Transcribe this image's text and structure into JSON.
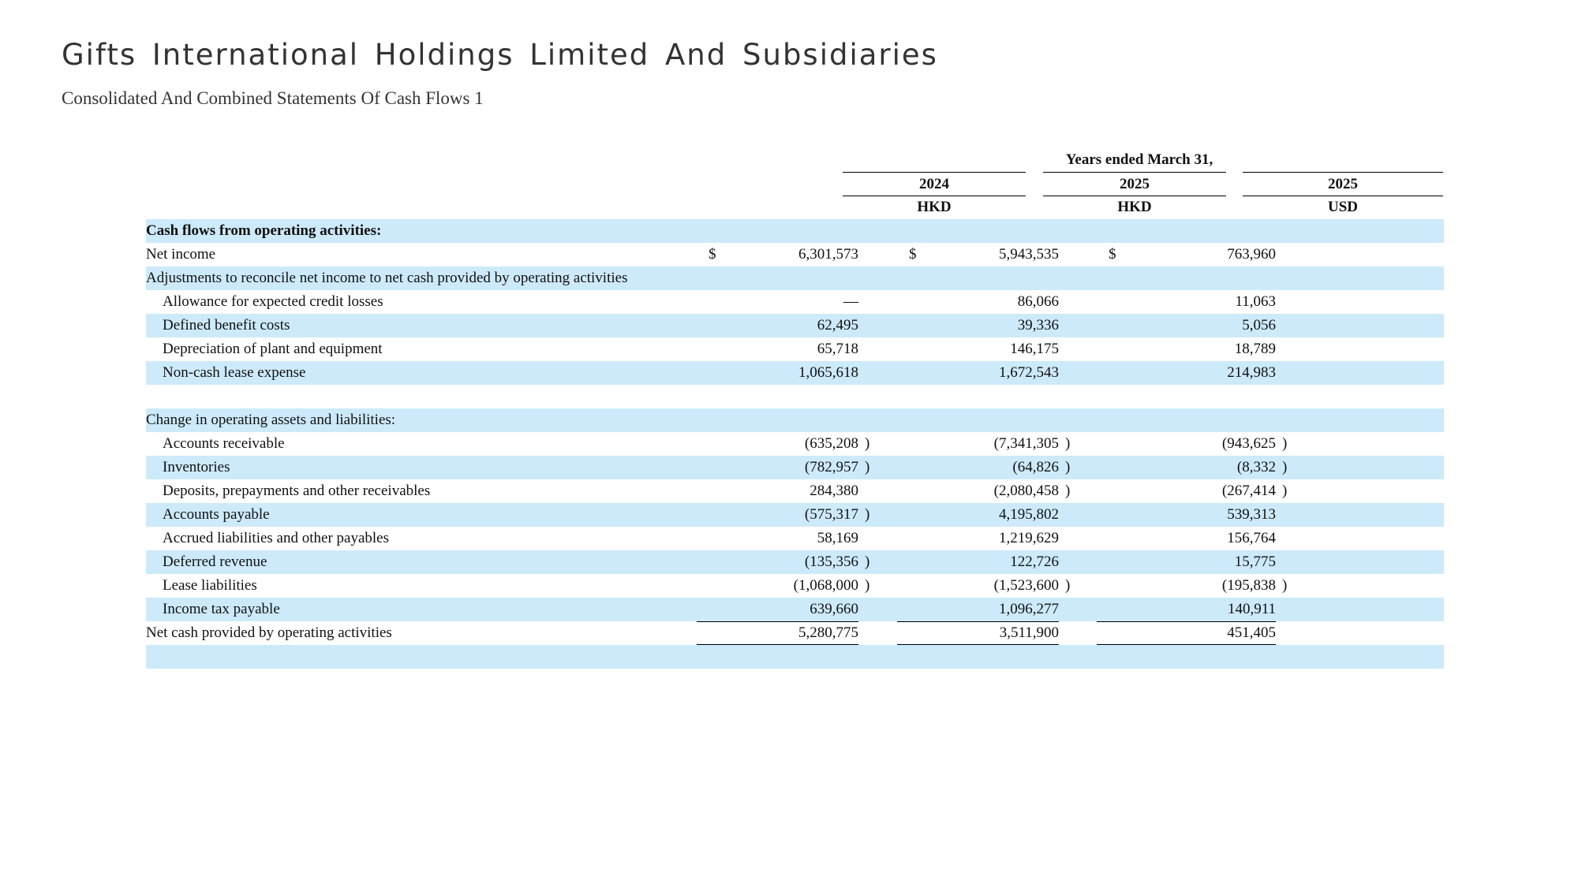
{
  "page": {
    "title": "Gifts International Holdings Limited And Subsidiaries",
    "subtitle": "Consolidated And Combined Statements Of Cash Flows 1"
  },
  "header": {
    "period": "Years ended March 31,",
    "columns": [
      {
        "year": "2024",
        "currency": "HKD"
      },
      {
        "year": "2025",
        "currency": "HKD"
      },
      {
        "year": "2025",
        "currency": "USD"
      }
    ]
  },
  "currency_symbol": "$",
  "rows": [
    {
      "label": "Cash flows from operating activities:",
      "bold": true,
      "indent": false,
      "values": [
        "",
        "",
        ""
      ],
      "paren": [
        false,
        false,
        false
      ]
    },
    {
      "label": "Net income",
      "indent": false,
      "dollar": true,
      "values": [
        "6,301,573",
        "5,943,535",
        "763,960"
      ],
      "paren": [
        false,
        false,
        false
      ]
    },
    {
      "label": "Adjustments to reconcile net income to net cash provided by operating activities",
      "indent": false,
      "values": [
        "",
        "",
        ""
      ],
      "paren": [
        false,
        false,
        false
      ]
    },
    {
      "label": "Allowance for expected credit losses",
      "indent": true,
      "values": [
        "—",
        "86,066",
        "11,063"
      ],
      "paren": [
        false,
        false,
        false
      ]
    },
    {
      "label": "Defined benefit costs",
      "indent": true,
      "values": [
        "62,495",
        "39,336",
        "5,056"
      ],
      "paren": [
        false,
        false,
        false
      ]
    },
    {
      "label": "Depreciation of plant and equipment",
      "indent": true,
      "values": [
        "65,718",
        "146,175",
        "18,789"
      ],
      "paren": [
        false,
        false,
        false
      ]
    },
    {
      "label": "Non-cash lease expense",
      "indent": true,
      "values": [
        "1,065,618",
        "1,672,543",
        "214,983"
      ],
      "paren": [
        false,
        false,
        false
      ]
    },
    {
      "label": "",
      "indent": false,
      "values": [
        "",
        "",
        ""
      ],
      "paren": [
        false,
        false,
        false
      ]
    },
    {
      "label": "Change in operating assets and liabilities:",
      "indent": false,
      "values": [
        "",
        "",
        ""
      ],
      "paren": [
        false,
        false,
        false
      ]
    },
    {
      "label": "Accounts receivable",
      "indent": true,
      "values": [
        "(635,208",
        "(7,341,305",
        "(943,625"
      ],
      "paren": [
        true,
        true,
        true
      ]
    },
    {
      "label": "Inventories",
      "indent": true,
      "values": [
        "(782,957",
        "(64,826",
        "(8,332"
      ],
      "paren": [
        true,
        true,
        true
      ]
    },
    {
      "label": "Deposits, prepayments and other receivables",
      "indent": true,
      "values": [
        "284,380",
        "(2,080,458",
        "(267,414"
      ],
      "paren": [
        false,
        true,
        true
      ]
    },
    {
      "label": "Accounts payable",
      "indent": true,
      "values": [
        "(575,317",
        "4,195,802",
        "539,313"
      ],
      "paren": [
        true,
        false,
        false
      ]
    },
    {
      "label": "Accrued liabilities and other payables",
      "indent": true,
      "values": [
        "58,169",
        "1,219,629",
        "156,764"
      ],
      "paren": [
        false,
        false,
        false
      ]
    },
    {
      "label": "Deferred revenue",
      "indent": true,
      "values": [
        "(135,356",
        "122,726",
        "15,775"
      ],
      "paren": [
        true,
        false,
        false
      ]
    },
    {
      "label": "Lease liabilities",
      "indent": true,
      "values": [
        "(1,068,000",
        "(1,523,600",
        "(195,838"
      ],
      "paren": [
        true,
        true,
        true
      ]
    },
    {
      "label": "Income tax payable",
      "indent": true,
      "values": [
        "639,660",
        "1,096,277",
        "140,911"
      ],
      "paren": [
        false,
        false,
        false
      ]
    },
    {
      "label": "Net cash provided by operating activities",
      "indent": false,
      "total": true,
      "values": [
        "5,280,775",
        "3,511,900",
        "451,405"
      ],
      "paren": [
        false,
        false,
        false
      ]
    },
    {
      "label": "",
      "indent": false,
      "values": [
        "",
        "",
        ""
      ],
      "paren": [
        false,
        false,
        false
      ]
    }
  ]
}
